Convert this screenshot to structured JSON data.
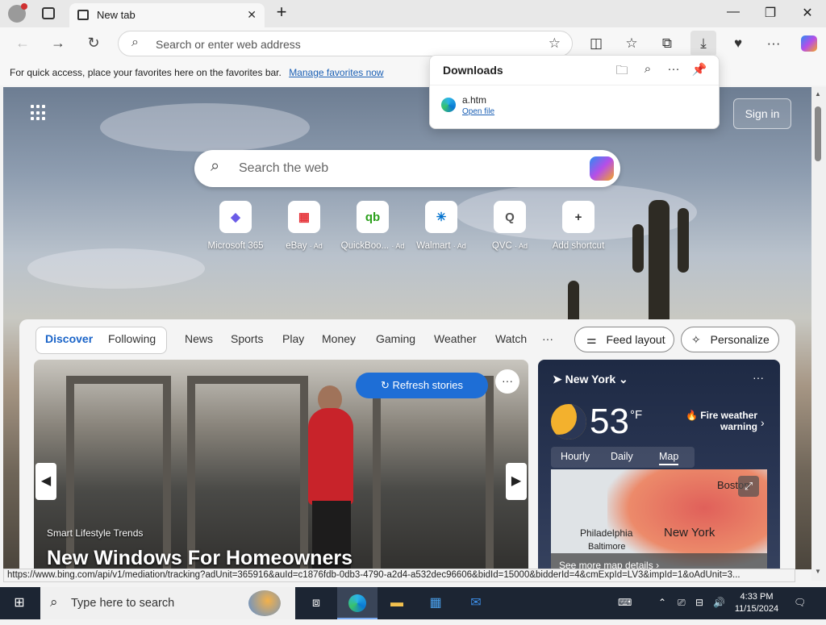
{
  "browser": {
    "tab_title": "New tab",
    "tab_close": "✕",
    "new_tab": "+",
    "address_placeholder": "Search or enter web address",
    "favorites_message": "For quick access, place your favorites here on the favorites bar.",
    "favorites_link": "Manage favorites now"
  },
  "downloads": {
    "title": "Downloads",
    "file_name": "a.htm",
    "open_file": "Open file"
  },
  "newtab": {
    "sign_in": "Sign in",
    "search_placeholder": "Search the web",
    "shortcuts": [
      {
        "label": "Microsoft 365",
        "ad": "",
        "icon": "microsoft-365-icon",
        "glyph": "◆",
        "color": "#6b5ce7"
      },
      {
        "label": "eBay",
        "ad": "· Ad",
        "icon": "ebay-icon",
        "glyph": "▦",
        "color": "#e53238"
      },
      {
        "label": "QuickBoo...",
        "ad": "· Ad",
        "icon": "quickbooks-icon",
        "glyph": "qb",
        "color": "#2ca01c"
      },
      {
        "label": "Walmart",
        "ad": "· Ad",
        "icon": "walmart-icon",
        "glyph": "✳",
        "color": "#0071ce"
      },
      {
        "label": "QVC",
        "ad": "· Ad",
        "icon": "qvc-icon",
        "glyph": "Q",
        "color": "#555555"
      },
      {
        "label": "Add shortcut",
        "ad": "",
        "icon": "plus-icon",
        "glyph": "+",
        "color": "#333333"
      }
    ]
  },
  "feed": {
    "tabs": [
      "Discover",
      "Following",
      "News",
      "Sports",
      "Play",
      "Money",
      "Gaming",
      "Weather",
      "Watch"
    ],
    "more": "···",
    "feed_layout": "Feed layout",
    "personalize": "Personalize",
    "refresh": "Refresh stories",
    "card_source": "Smart Lifestyle Trends",
    "card_title": "New Windows For Homeowners"
  },
  "weather": {
    "location": "New York",
    "temp": "53",
    "unit": "°F",
    "alert": "Fire weather warning",
    "tabs": [
      "Hourly",
      "Daily",
      "Map"
    ],
    "active_tab": "Map",
    "cities": [
      "Boston",
      "Philadelphia",
      "New York",
      "Baltimore"
    ],
    "map_footer": "See more map details"
  },
  "status_url": "https://www.bing.com/api/v1/mediation/tracking?adUnit=365916&auId=c1876fdb-0db3-4790-a2d4-a532dec96606&bidId=15000&bidderId=4&cmExpId=LV3&impId=1&oAdUnit=3...",
  "taskbar": {
    "search_placeholder": "Type here to search",
    "time": "4:33 PM",
    "date": "11/15/2024"
  },
  "colors": {
    "accent": "#1e6ed6",
    "link": "#1a5fb4",
    "taskbar": "#1c2533"
  }
}
